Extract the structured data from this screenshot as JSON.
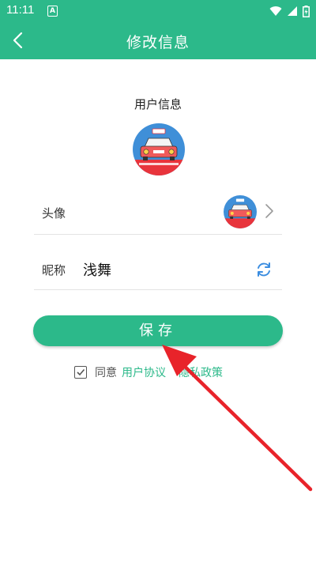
{
  "status_bar": {
    "time": "11:11",
    "badge": "A"
  },
  "nav": {
    "title": "修改信息"
  },
  "section_title": "用户信息",
  "avatar_row": {
    "label": "头像"
  },
  "nickname_row": {
    "label": "昵称",
    "value": "浅舞"
  },
  "save_button": {
    "label": "保存"
  },
  "agreement": {
    "prefix": "同意",
    "link1": "用户协议",
    "link2": "隐私政策"
  },
  "colors": {
    "accent": "#2cb98a",
    "arrow": "#e8232a"
  },
  "icons": [
    "back-arrow-icon",
    "chevron-right-icon",
    "refresh-icon",
    "checkbox-checked-icon",
    "wifi-icon",
    "signal-icon",
    "battery-icon"
  ]
}
